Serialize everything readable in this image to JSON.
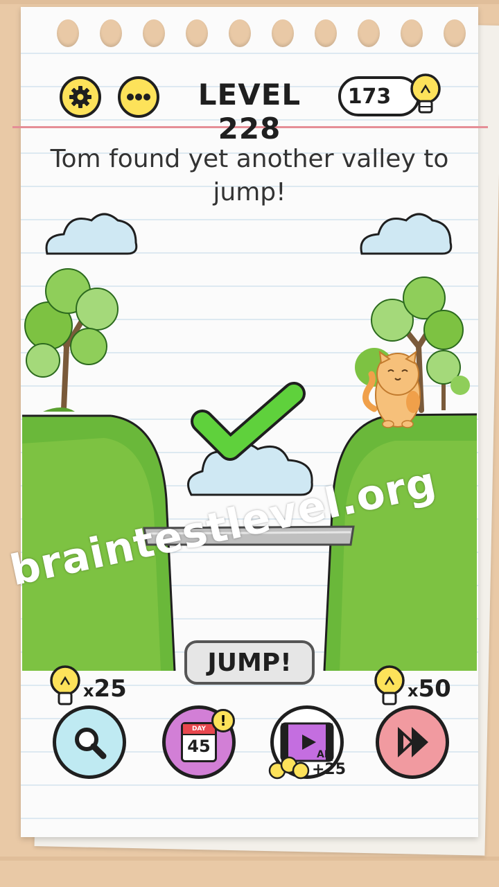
{
  "header": {
    "level_title": "LEVEL 228",
    "hint_count": "173"
  },
  "question": {
    "text": "Tom found yet another valley to jump!"
  },
  "game": {
    "action_label": "JUMP!",
    "result": "correct"
  },
  "watermark": "braintestlevel.org",
  "bottom_bar": {
    "hint_cost_prefix": "x",
    "hint_cost": "25",
    "daily_day_label": "DAY",
    "daily_day_number": "45",
    "daily_alert": "!",
    "ad_label": "AD",
    "ad_reward": "+25",
    "skip_cost_prefix": "x",
    "skip_cost": "50"
  },
  "colors": {
    "accent_yellow": "#fde25a",
    "grass": "#7dc242",
    "check": "#5fd13c",
    "cloud": "#cfe8f3",
    "hint_button": "#bfeaf2",
    "daily_button": "#d27fd6",
    "skip_button": "#f19aa0"
  },
  "icons": [
    "gear-icon",
    "more-icon",
    "lightbulb-icon",
    "magnifier-icon",
    "calendar-icon",
    "video-icon",
    "skip-icon",
    "checkmark-icon"
  ]
}
